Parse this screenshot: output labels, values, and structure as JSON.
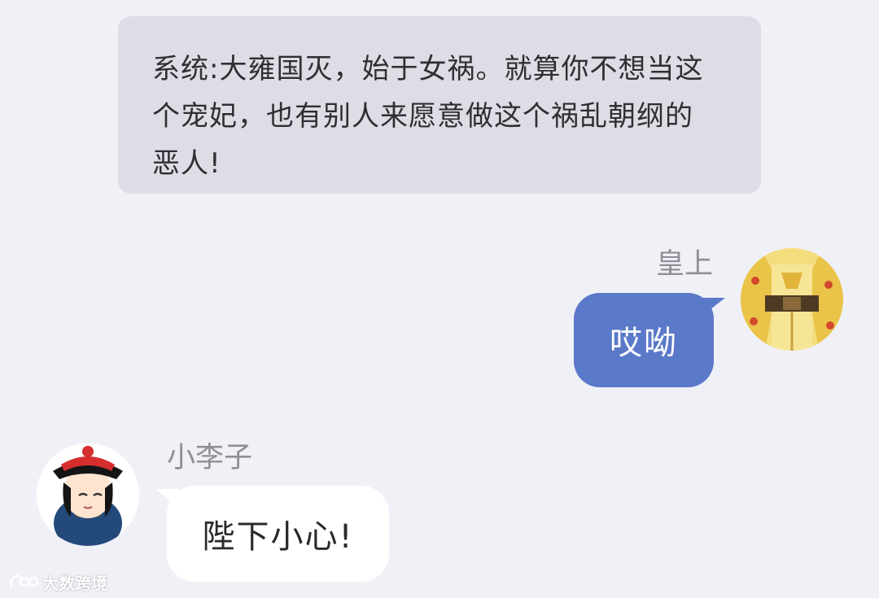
{
  "colors": {
    "background": "#f0f0f7",
    "system_bubble": "#dcdde5",
    "outgoing_bubble": "#5b79c9",
    "incoming_bubble": "#ffffff",
    "name_text": "#8e8f96"
  },
  "system_message": {
    "line1": "系统:大雍国灭，始于女祸。就算你不想当这",
    "line2": "个宠妃，也有别人来愿意做这个祸乱朝纲的",
    "line3": "恶人!"
  },
  "messages": [
    {
      "sender": "皇上",
      "text": "哎呦",
      "side": "right",
      "avatar_icon": "emperor-avatar-icon"
    },
    {
      "sender": "小李子",
      "text": "陛下小心!",
      "side": "left",
      "avatar_icon": "eunuch-avatar-icon"
    }
  ],
  "watermark": {
    "text": "大数跨境",
    "icon": "watermark-logo-icon"
  }
}
